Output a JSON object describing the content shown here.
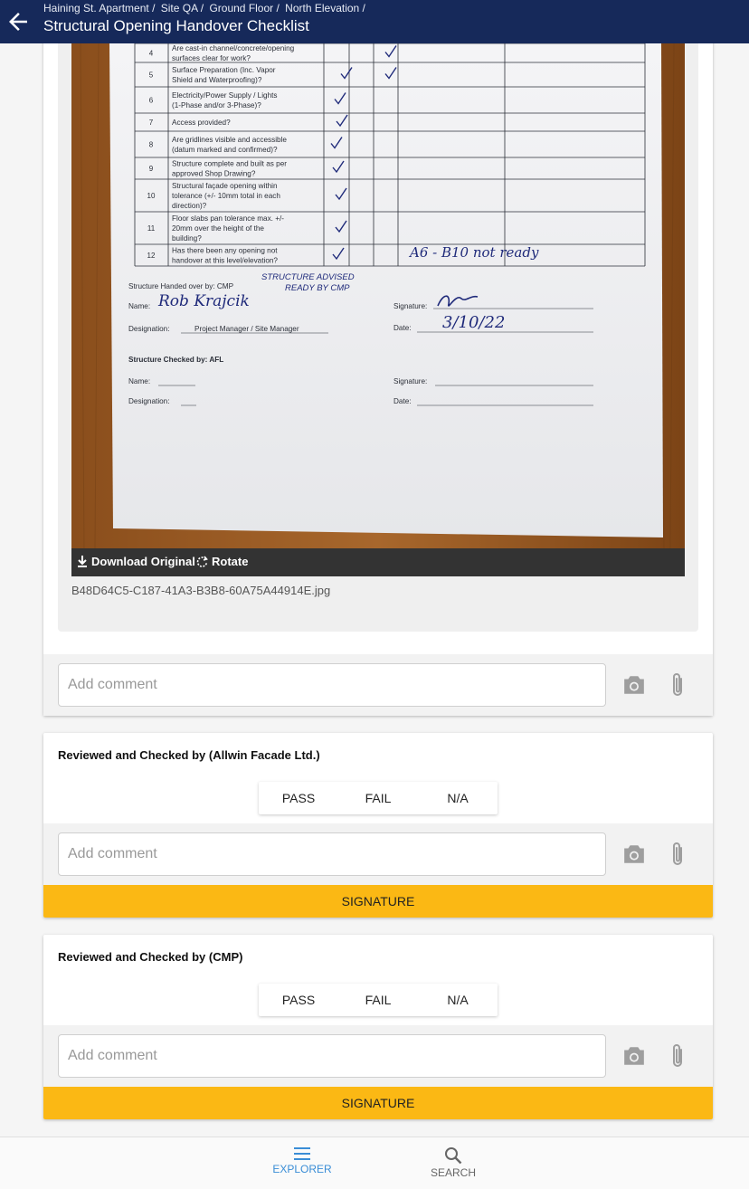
{
  "breadcrumb": [
    "Haining St. Apartment /",
    "Site QA /",
    "Ground Floor /",
    "North Elevation /"
  ],
  "title": "Structural Opening Handover Checklist",
  "attachment": {
    "download_label": "Download Original",
    "rotate_label": "Rotate",
    "filename": "B48D64C5-C187-41A3-B3B8-60A75A44914E.jpg",
    "document": {
      "rows": [
        {
          "no": "4",
          "text": [
            "Are cast-in channel/concrete/opening",
            "surfaces clear for work?"
          ]
        },
        {
          "no": "5",
          "text": [
            "Surface Preparation (Inc. Vapor",
            "Shield and Waterproofing)?"
          ]
        },
        {
          "no": "6",
          "text": [
            "Electricity/Power Supply / Lights",
            "(1-Phase and/or 3-Phase)?"
          ]
        },
        {
          "no": "7",
          "text": [
            "Access provided?"
          ]
        },
        {
          "no": "8",
          "text": [
            "Are gridlines visible and accessible",
            "(datum marked and confirmed)?"
          ]
        },
        {
          "no": "9",
          "text": [
            "Structure complete and built as per",
            "approved Shop Drawing?"
          ]
        },
        {
          "no": "10",
          "text": [
            "Structural façade opening within",
            "tolerance (+/- 10mm total in each",
            "direction)?"
          ]
        },
        {
          "no": "11",
          "text": [
            "Floor slabs pan tolerance max. +/-",
            "20mm over the height of the",
            "building?"
          ]
        },
        {
          "no": "12",
          "text": [
            "Has there been any opening not",
            "handover at this level/elevation?"
          ]
        }
      ],
      "handwritten_note": "A6 - B10 not ready",
      "handed_over_label": "Structure Handed over by: CMP",
      "handed_over_note": [
        "STRUCTURE ADVISED",
        "READY BY CMP"
      ],
      "name_label": "Name:",
      "name_value": "Rob Krajcik",
      "signature_label": "Signature:",
      "designation_label": "Designation:",
      "designation_value": "Project Manager / Site Manager",
      "date_label": "Date:",
      "date_value": "3/10/22",
      "checked_by_label": "Structure Checked by: AFL",
      "name2_label": "Name:",
      "signature2_label": "Signature:",
      "designation2_label": "Designation:",
      "date2_label": "Date:"
    }
  },
  "comment_placeholder": "Add comment",
  "sections": [
    {
      "title": "Reviewed and Checked by (Allwin Facade Ltd.)",
      "pass": "PASS",
      "fail": "FAIL",
      "na": "N/A",
      "signature": "SIGNATURE"
    },
    {
      "title": "Reviewed and Checked by (CMP)",
      "pass": "PASS",
      "fail": "FAIL",
      "na": "N/A",
      "signature": "SIGNATURE"
    }
  ],
  "nav": {
    "explorer": "EXPLORER",
    "search": "SEARCH"
  },
  "colors": {
    "appbar": "#16295a",
    "signature_button": "#fbb814",
    "nav_active": "#3a8dd6"
  }
}
